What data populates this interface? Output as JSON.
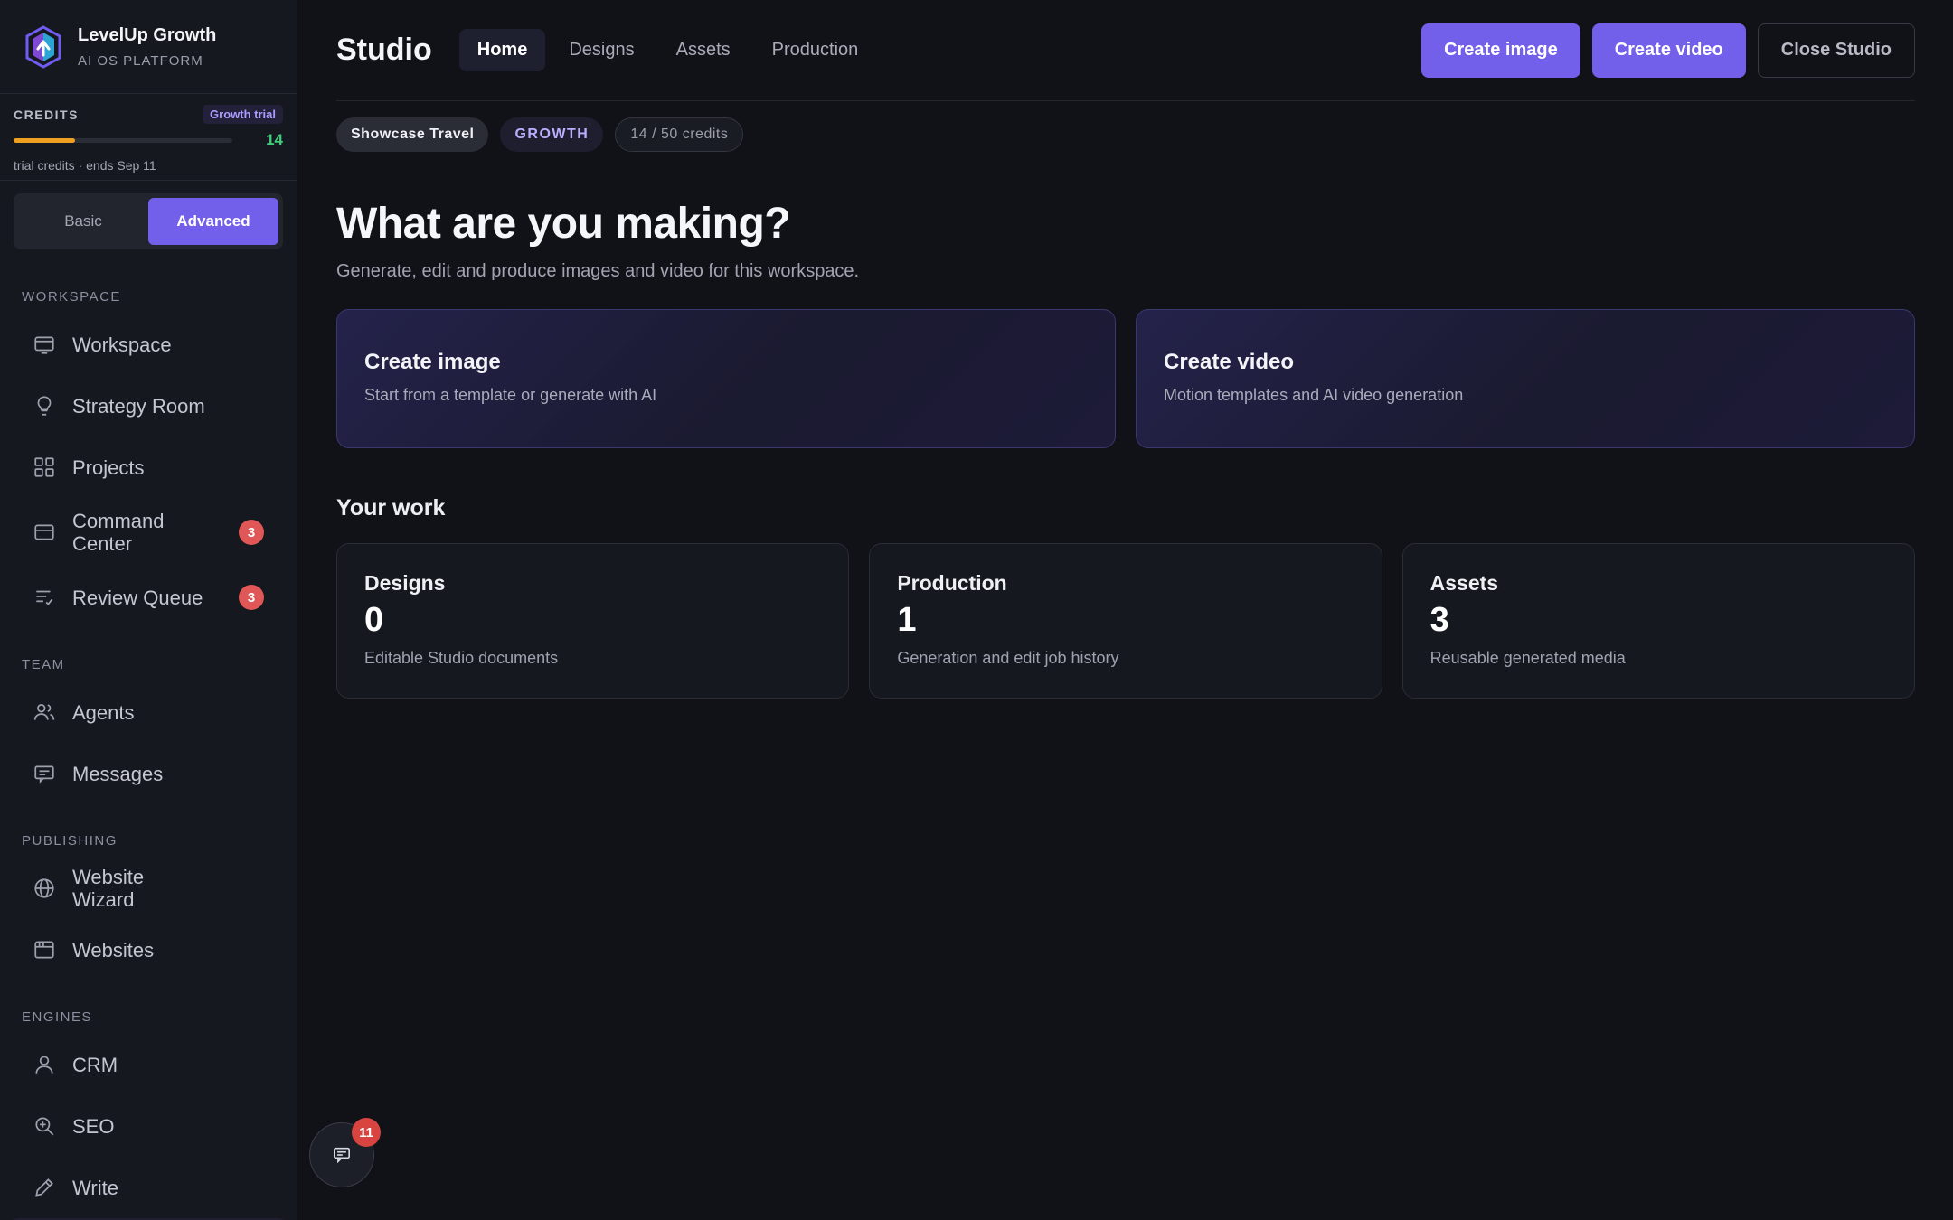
{
  "brand": {
    "name": "LevelUp Growth",
    "subtitle": "AI OS PLATFORM"
  },
  "credits": {
    "label": "CREDITS",
    "plan_badge": "Growth trial",
    "remaining": "14",
    "used_fraction": 0.28,
    "note": "trial credits · ends Sep 11",
    "bar_color": "#f0a020"
  },
  "mode_toggle": {
    "basic": "Basic",
    "advanced": "Advanced",
    "selected": "Advanced"
  },
  "sidebar": {
    "sections": [
      {
        "title": "WORKSPACE",
        "items": [
          {
            "label": "Workspace",
            "icon": "monitor-icon"
          },
          {
            "label": "Strategy Room",
            "icon": "lightbulb-icon"
          },
          {
            "label": "Projects",
            "icon": "grid-icon"
          },
          {
            "label": "Command Center",
            "icon": "window-icon",
            "badge": "3"
          },
          {
            "label": "Review Queue",
            "icon": "checklist-icon",
            "badge": "3"
          }
        ]
      },
      {
        "title": "TEAM",
        "items": [
          {
            "label": "Agents",
            "icon": "users-icon"
          },
          {
            "label": "Messages",
            "icon": "message-icon"
          }
        ]
      },
      {
        "title": "PUBLISHING",
        "items": [
          {
            "label": "Website Wizard",
            "icon": "globe-icon"
          },
          {
            "label": "Websites",
            "icon": "browser-icon"
          }
        ]
      },
      {
        "title": "ENGINES",
        "items": [
          {
            "label": "CRM",
            "icon": "user-icon"
          },
          {
            "label": "SEO",
            "icon": "search-zoom-icon"
          },
          {
            "label": "Write",
            "icon": "pencil-icon"
          }
        ]
      }
    ]
  },
  "header": {
    "title": "Studio",
    "tabs": [
      "Home",
      "Designs",
      "Assets",
      "Production"
    ],
    "active_tab": "Home",
    "actions": {
      "create_image": "Create image",
      "create_video": "Create video",
      "close": "Close Studio"
    }
  },
  "chips": {
    "workspace": "Showcase Travel",
    "plan": "GROWTH",
    "credits": "14 / 50 credits"
  },
  "hero": {
    "title": "What are you making?",
    "subtitle": "Generate, edit and produce images and video for this workspace."
  },
  "create_cards": [
    {
      "title": "Create image",
      "desc": "Start from a template or generate with AI"
    },
    {
      "title": "Create video",
      "desc": "Motion templates and AI video generation"
    }
  ],
  "your_work": {
    "title": "Your work",
    "cards": [
      {
        "title": "Designs",
        "count": "0",
        "desc": "Editable Studio documents"
      },
      {
        "title": "Production",
        "count": "1",
        "desc": "Generation and edit job history"
      },
      {
        "title": "Assets",
        "count": "3",
        "desc": "Reusable generated media"
      }
    ]
  },
  "chat": {
    "badge": "11",
    "icon": "chat-icon"
  },
  "colors": {
    "accent": "#7260ea",
    "badge_red": "#e05757",
    "success": "#3ecf7a"
  }
}
